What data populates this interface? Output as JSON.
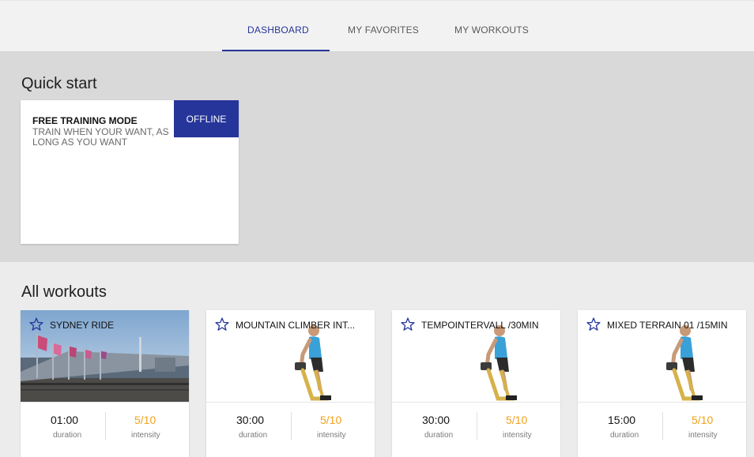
{
  "nav": {
    "tabs": [
      {
        "label": "DASHBOARD",
        "active": true
      },
      {
        "label": "MY FAVORITES",
        "active": false
      },
      {
        "label": "MY WORKOUTS",
        "active": false
      }
    ]
  },
  "quick_start": {
    "title": "Quick start",
    "card": {
      "title": "FREE TRAINING MODE",
      "subtitle": "TRAIN WHEN YOUR WANT, AS LONG AS YOU WANT",
      "button": "OFFLINE"
    }
  },
  "all_workouts": {
    "title": "All workouts",
    "items": [
      {
        "title": "SYDNEY RIDE",
        "image": "city-bridge-photo",
        "duration": "01:00",
        "duration_label": "duration",
        "intensity": "5/10",
        "intensity_label": "intensity"
      },
      {
        "title": "MOUNTAIN CLIMBER INT...",
        "image": "cyclist-on-bike",
        "duration": "30:00",
        "duration_label": "duration",
        "intensity": "5/10",
        "intensity_label": "intensity"
      },
      {
        "title": "TEMPOINTERVALL /30MIN",
        "image": "cyclist-on-bike",
        "duration": "30:00",
        "duration_label": "duration",
        "intensity": "5/10",
        "intensity_label": "intensity"
      },
      {
        "title": "MIXED TERRAIN 01 /15MIN",
        "image": "cyclist-on-bike",
        "duration": "15:00",
        "duration_label": "duration",
        "intensity": "5/10",
        "intensity_label": "intensity"
      }
    ]
  },
  "colors": {
    "accent": "#26359a",
    "intensity": "#f0a21b"
  }
}
